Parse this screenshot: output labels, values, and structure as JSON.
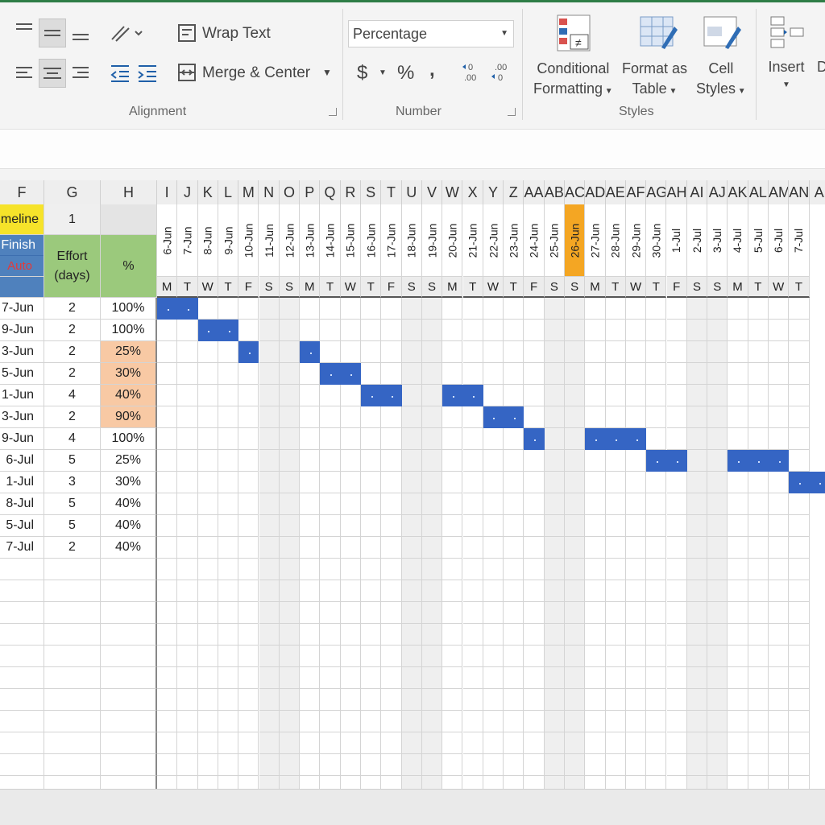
{
  "ribbon": {
    "wrap_text": "Wrap Text",
    "merge_center": "Merge & Center",
    "alignment_label": "Alignment",
    "number_format": "Percentage",
    "currency": "$",
    "percent": "%",
    "comma": ",",
    "number_label": "Number",
    "conditional_formatting_line1": "Conditional",
    "conditional_formatting_line2": "Formatting",
    "format_as_table_line1": "Format as",
    "format_as_table_line2": "Table",
    "cell_styles_line1": "Cell",
    "cell_styles_line2": "Styles",
    "styles_label": "Styles",
    "insert_label": "Insert",
    "delete_label": "D"
  },
  "columns": [
    "F",
    "G",
    "H",
    "I",
    "J",
    "K",
    "L",
    "M",
    "N",
    "O",
    "P",
    "Q",
    "R",
    "S",
    "T",
    "U",
    "V",
    "W",
    "X",
    "Y",
    "Z",
    "AA",
    "AB",
    "AC",
    "AD",
    "AE",
    "AF",
    "AG",
    "AH",
    "AI",
    "AJ",
    "AK",
    "AL",
    "AM",
    "AN",
    "A"
  ],
  "header_rows": {
    "timeline_label": "meline",
    "timeline_value": "1",
    "finish_label": "Finish",
    "auto_label": "Auto",
    "effort_label": "Effort (days)",
    "percent_label": "%"
  },
  "dates": [
    "6-Jun",
    "7-Jun",
    "8-Jun",
    "9-Jun",
    "10-Jun",
    "11-Jun",
    "12-Jun",
    "13-Jun",
    "14-Jun",
    "15-Jun",
    "16-Jun",
    "17-Jun",
    "18-Jun",
    "19-Jun",
    "20-Jun",
    "21-Jun",
    "22-Jun",
    "23-Jun",
    "24-Jun",
    "25-Jun",
    "26-Jun",
    "27-Jun",
    "28-Jun",
    "29-Jun",
    "30-Jun",
    "1-Jul",
    "2-Jul",
    "3-Jul",
    "4-Jul",
    "5-Jul",
    "6-Jul",
    "7-Jul"
  ],
  "weekdays": [
    "M",
    "T",
    "W",
    "T",
    "F",
    "S",
    "S",
    "M",
    "T",
    "W",
    "T",
    "F",
    "S",
    "S",
    "M",
    "T",
    "W",
    "T",
    "F",
    "S",
    "S",
    "M",
    "T",
    "W",
    "T",
    "F",
    "S",
    "S",
    "M",
    "T",
    "W",
    "T"
  ],
  "today_index": 20,
  "tasks": [
    {
      "finish": "7-Jun",
      "effort": "2",
      "pct": "100%",
      "start": 0,
      "days": 2
    },
    {
      "finish": "9-Jun",
      "effort": "2",
      "pct": "100%",
      "start": 2,
      "days": 2
    },
    {
      "finish": "3-Jun",
      "effort": "2",
      "pct": "25%",
      "start": 4,
      "days": 1,
      "extra": [
        7,
        1
      ]
    },
    {
      "finish": "5-Jun",
      "effort": "2",
      "pct": "30%",
      "start": 8,
      "days": 2
    },
    {
      "finish": "1-Jun",
      "effort": "4",
      "pct": "40%",
      "start": 10,
      "days": 2,
      "extra": [
        14,
        2
      ]
    },
    {
      "finish": "3-Jun",
      "effort": "2",
      "pct": "90%",
      "start": 16,
      "days": 2
    },
    {
      "finish": "9-Jun",
      "effort": "4",
      "pct": "100%",
      "start": 18,
      "days": 1,
      "extra": [
        21,
        3
      ]
    },
    {
      "finish": "6-Jul",
      "effort": "5",
      "pct": "25%",
      "start": 24,
      "days": 2,
      "extra": [
        28,
        3
      ]
    },
    {
      "finish": "1-Jul",
      "effort": "3",
      "pct": "30%",
      "start": 31,
      "days": 2
    },
    {
      "finish": "8-Jul",
      "effort": "5",
      "pct": "40%"
    },
    {
      "finish": "5-Jul",
      "effort": "5",
      "pct": "40%"
    },
    {
      "finish": "7-Jul",
      "effort": "2",
      "pct": "40%"
    }
  ],
  "colors": {
    "bar": "#3565c4",
    "weekend": "#efefef",
    "today": "#f4a623",
    "yellow": "#f6e32a",
    "blue": "#4f81bd",
    "green": "#9bc97c",
    "peach": "#f8c9a4"
  }
}
